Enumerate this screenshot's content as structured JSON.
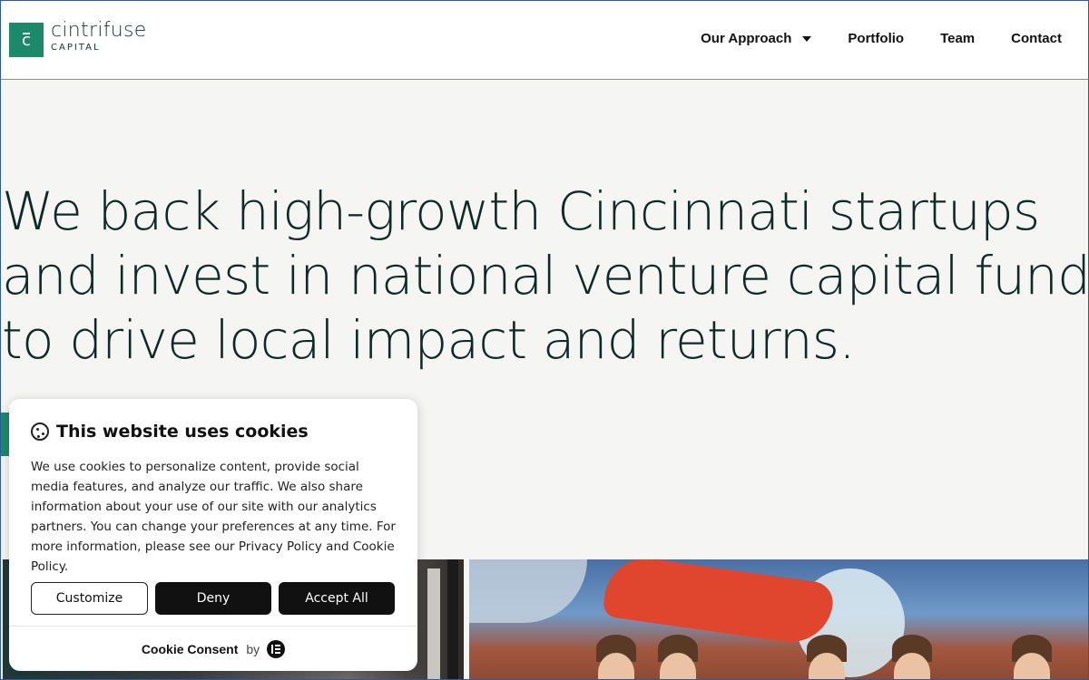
{
  "brand": {
    "name": "cintrifuse",
    "sub": "CAPITAL",
    "color": "#1b8a6b"
  },
  "nav": {
    "items": [
      {
        "label": "Our Approach"
      },
      {
        "label": "Portfolio"
      },
      {
        "label": "Team"
      },
      {
        "label": "Contact"
      }
    ]
  },
  "hero": {
    "lines": [
      "We back high-growth Cincinnati startups",
      "and invest in national venture capital funds",
      "to drive local impact and returns."
    ]
  },
  "cookie": {
    "title": "This website uses cookies",
    "body": "We use cookies to personalize content, provide social media features, and analyze our traffic. We also share information about your use of our site with our analytics partners. You can change your preferences at any time. For more information, please see our Privacy Policy and Cookie Policy.",
    "buttons": {
      "customize": "Customize",
      "deny": "Deny",
      "accept": "Accept All"
    },
    "footer": {
      "brand": "Cookie Consent",
      "by": "by"
    }
  }
}
